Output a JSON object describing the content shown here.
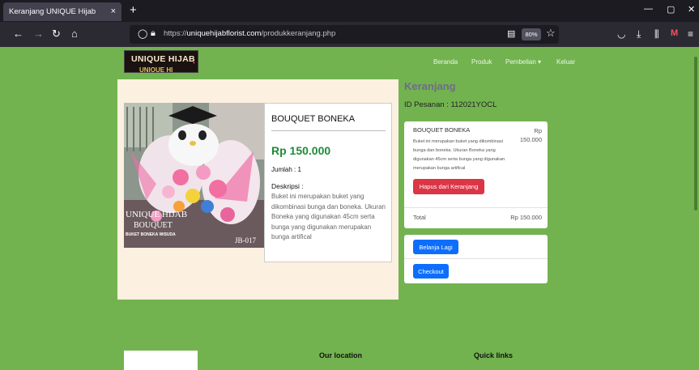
{
  "browser": {
    "tab_title": "Keranjang UNIQUE Hijab",
    "tab_close": "×",
    "new_tab": "+",
    "url_prefix": "https://",
    "url_host": "uniquehijabflorist.com",
    "url_path": "/produkkeranjang.php",
    "zoom": "80%"
  },
  "site": {
    "logo_line1": "UNIQUE HIJAB",
    "logo_line2": "UNIQUE HI",
    "nav": [
      "Beranda",
      "Produk",
      "Pembelian ▾",
      "Keluar"
    ]
  },
  "product": {
    "image_text": {
      "brand": "UNIQUE HIJAB",
      "line2": "BOUQUET",
      "line3": "BUKET BONEKA WISUDA",
      "code": "JB-017"
    },
    "title": "BOUQUET BONEKA",
    "price": "Rp 150.000",
    "quantity": "Jumlah : 1",
    "description_label": "Deskripsi :",
    "description": "Buket ini merupakan buket yang dikombinasi bunga dan boneka. Ukuran Boneka yang digunakan 45cm serta bunga yang digunakan merupakan bunga artifical"
  },
  "cart": {
    "title": "Keranjang",
    "order_id": "ID Pesanan : 112021YOCL",
    "item_name": "BOUQUET BONEKA",
    "item_desc": "Buket ini merupakan buket yang dikombinasi bunga dan boneka. Ukuran Boneka yang digunakan 45cm serta bunga yang digunakan merupakan bunga artifical",
    "item_price": "Rp 150.000",
    "remove_button": "Hapus dari Keranjang",
    "total_label": "Total",
    "total_value": "Rp 150.000",
    "continue_button": "Belanja Lagi",
    "checkout_button": "Checkout"
  },
  "footer": {
    "location_heading": "Our location",
    "links_heading": "Quick links"
  },
  "colors": {
    "page_bg": "#72b350",
    "panel_bg": "#fcf0e0",
    "price_green": "#1e8a3a",
    "danger": "#dc3545",
    "primary": "#0d6efd"
  }
}
